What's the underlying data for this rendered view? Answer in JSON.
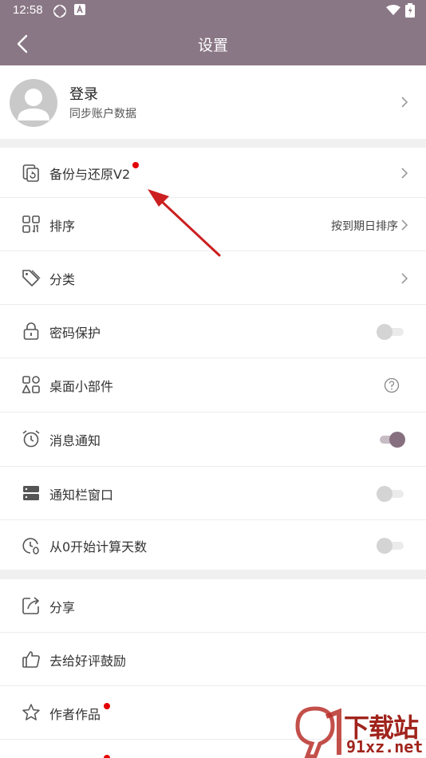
{
  "status_bar": {
    "time": "12:58"
  },
  "app_bar": {
    "title": "设置"
  },
  "profile": {
    "name": "登录",
    "subtitle": "同步账户数据"
  },
  "section1": {
    "backup": {
      "label": "备份与还原V2",
      "has_badge": true
    },
    "sort": {
      "label": "排序",
      "value": "按到期日排序"
    },
    "category": {
      "label": "分类"
    },
    "password": {
      "label": "密码保护",
      "enabled": false
    },
    "widget": {
      "label": "桌面小部件"
    },
    "notification": {
      "label": "消息通知",
      "enabled": true
    },
    "notify_bar": {
      "label": "通知栏窗口",
      "enabled": false
    },
    "count_from_zero": {
      "label": "从0开始计算天数",
      "enabled": false
    }
  },
  "section2": {
    "share": {
      "label": "分享"
    },
    "rate": {
      "label": "去给好评鼓励"
    },
    "author_works": {
      "label": "作者作品",
      "has_badge": true
    }
  },
  "watermark": {
    "brand": "下载站",
    "url": "91xz.net"
  },
  "colors": {
    "primary": "#8a7785",
    "badge": "#e30000",
    "annotation_arrow": "#cc1f1f"
  }
}
